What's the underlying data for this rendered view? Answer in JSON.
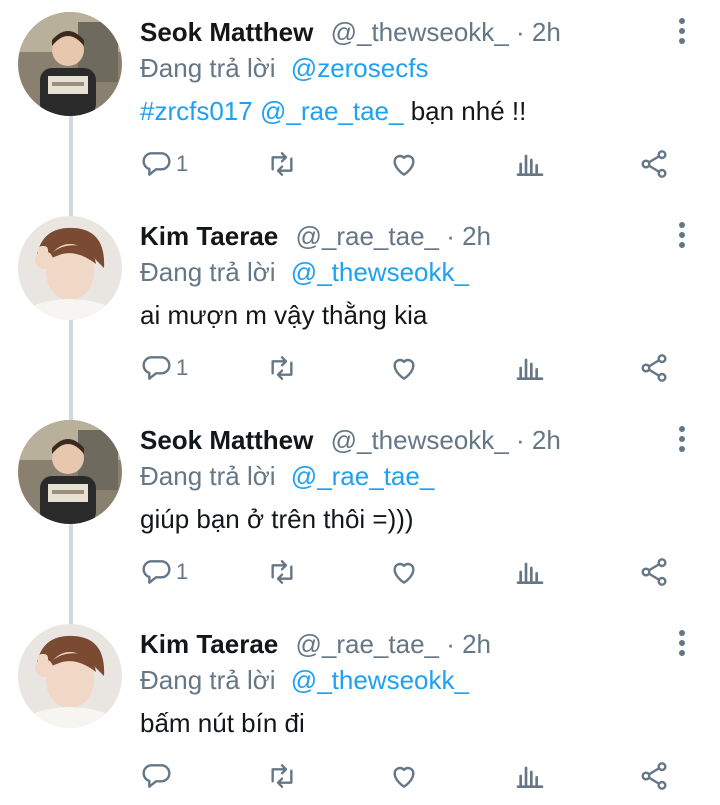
{
  "tweets": [
    {
      "name": "Seok Matthew",
      "handle_time": "@_thewseokk_ · 2h",
      "reply_prefix": "Đang trả lời",
      "reply_to": "@zerosecfs",
      "body_links": [
        "#zrcfs017",
        "@_rae_tae_"
      ],
      "body_text": "bạn nhé !!",
      "reply_count": "1",
      "avatar": "avatar-seok-matthew"
    },
    {
      "name": "Kim Taerae",
      "handle_time": "@_rae_tae_ · 2h",
      "reply_prefix": "Đang trả lời",
      "reply_to": "@_thewseokk_",
      "body_text": "ai mượn m vậy thằng kia",
      "reply_count": "1",
      "avatar": "avatar-kim-taerae"
    },
    {
      "name": "Seok Matthew",
      "handle_time": "@_thewseokk_ · 2h",
      "reply_prefix": "Đang trả lời",
      "reply_to": "@_rae_tae_",
      "body_text": "giúp bạn ở trên thôi =)))",
      "reply_count": "1",
      "avatar": "avatar-seok-matthew"
    },
    {
      "name": "Kim Taerae",
      "handle_time": "@_rae_tae_ · 2h",
      "reply_prefix": "Đang trả lời",
      "reply_to": "@_thewseokk_",
      "body_text": "bấm nút bín đi",
      "reply_count": "",
      "avatar": "avatar-kim-taerae"
    }
  ],
  "icons": {
    "reply": "reply-icon",
    "retweet": "retweet-icon",
    "like": "heart-icon",
    "analytics": "analytics-icon",
    "share": "share-icon",
    "more": "more-vertical-icon"
  },
  "colors": {
    "link": "#1da1f2",
    "secondary_text": "#657786",
    "thread_line": "#cfd9de"
  }
}
